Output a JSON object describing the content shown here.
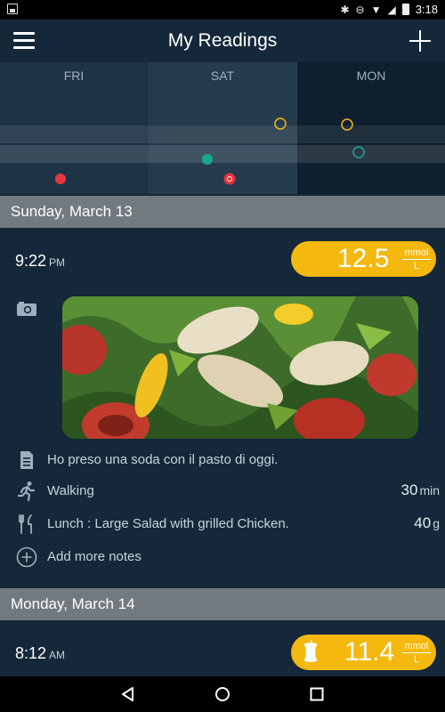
{
  "status_bar": {
    "time": "3:18"
  },
  "app_bar": {
    "title": "My Readings"
  },
  "chart_data": {
    "type": "scatter",
    "columns": [
      "FRI",
      "SAT",
      "MON"
    ],
    "highlighted_column": "SAT",
    "series": [
      {
        "marker": "filled-red",
        "points": [
          {
            "day": "FRI"
          },
          {
            "day": "SAT"
          }
        ]
      },
      {
        "marker": "filled-teal",
        "points": [
          {
            "day": "SAT"
          }
        ]
      },
      {
        "marker": "hollow-yellow",
        "points": [
          {
            "day": "SAT"
          },
          {
            "day": "MON"
          }
        ]
      },
      {
        "marker": "hollow-teal",
        "points": [
          {
            "day": "MON"
          }
        ]
      }
    ]
  },
  "days": [
    {
      "header": "Sunday, March 13",
      "entry": {
        "time": "9:22",
        "ampm": "PM",
        "reading": "12.5",
        "unit_top": "mmol",
        "unit_bottom": "L",
        "note": "Ho preso una soda con il pasto di oggi.",
        "activity": {
          "label": "Walking",
          "value": "30",
          "unit": "min"
        },
        "meal": {
          "label": "Lunch : Large Salad with grilled Chicken.",
          "value": "40",
          "unit": "g"
        },
        "add_notes": "Add more notes"
      }
    },
    {
      "header": "Monday, March 14",
      "entry": {
        "time": "8:12",
        "ampm": "AM",
        "reading": "11.4",
        "unit_top": "mmol",
        "unit_bottom": "L"
      }
    }
  ],
  "colors": {
    "accent": "#f5b80f",
    "background": "#14283a",
    "header": "#727a80",
    "red": "#e8343f",
    "teal": "#17a98f"
  }
}
